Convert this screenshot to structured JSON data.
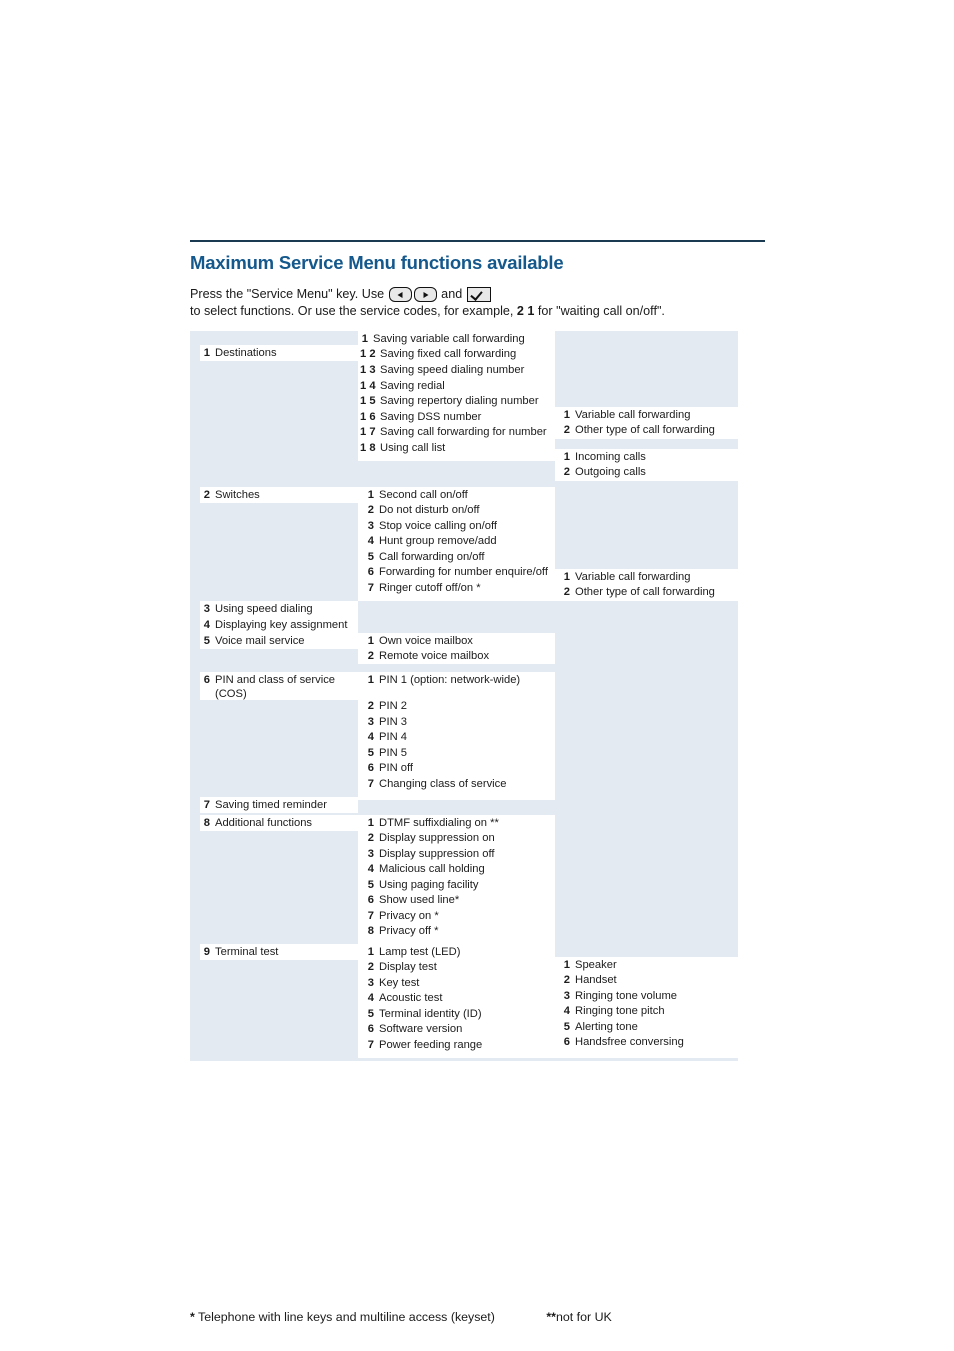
{
  "header": {
    "title": "Maximum Service Menu functions available",
    "intro_line1_a": "Press the \"Service Menu\" key. Use ",
    "intro_line1_b": " and ",
    "intro_line2_a": "to select functions. Or use the service codes, for example, ",
    "intro_line2_code": "2 1",
    "intro_line2_b": " for \"waiting call on/off\"."
  },
  "icons": {
    "left_key": "left-arrow-key-icon",
    "right_key": "right-arrow-key-icon",
    "ok_key": "checkmark-key-icon"
  },
  "table": {
    "col1": [
      {
        "num": "1",
        "label": "Destinations"
      },
      {
        "num": "2",
        "label": "Switches"
      },
      {
        "num": "3",
        "label": "Using speed dialing"
      },
      {
        "num": "4",
        "label": "Displaying key assignment"
      },
      {
        "num": "5",
        "label": "Voice mail service"
      },
      {
        "num": "6",
        "label": "PIN and class of service",
        "label2": "(COS)"
      },
      {
        "num": "7",
        "label": "Saving timed reminder"
      },
      {
        "num": "8",
        "label": "Additional functions"
      },
      {
        "num": "9",
        "label": "Terminal test"
      }
    ],
    "col2_destinations": [
      {
        "num": "1",
        "label": "Saving variable call forwarding"
      },
      {
        "num": "1 2",
        "label": "Saving fixed call forwarding"
      },
      {
        "num": "1 3",
        "label": "Saving speed dialing number"
      },
      {
        "num": "1 4",
        "label": "Saving redial"
      },
      {
        "num": "1 5",
        "label": "Saving repertory dialing number"
      },
      {
        "num": "1 6",
        "label": "Saving DSS number"
      },
      {
        "num": "1 7",
        "label": "Saving call forwarding for number"
      },
      {
        "num": "1 8",
        "label": "Using call list"
      }
    ],
    "col2_switches": [
      {
        "num": "1",
        "label": "Second call on/off"
      },
      {
        "num": "2",
        "label": "Do not disturb on/off"
      },
      {
        "num": "3",
        "label": "Stop voice calling on/off"
      },
      {
        "num": "4",
        "label": "Hunt group remove/add"
      },
      {
        "num": "5",
        "label": "Call forwarding on/off"
      },
      {
        "num": "6",
        "label": "Forwarding for number enquire/off"
      },
      {
        "num": "7",
        "label": "Ringer cutoff off/on  *"
      }
    ],
    "col2_voicemail": [
      {
        "num": "1",
        "label": "Own voice mailbox"
      },
      {
        "num": "2",
        "label": "Remote voice mailbox"
      }
    ],
    "col2_pin": [
      {
        "num": "1",
        "label": "PIN 1 (option: network-wide)"
      },
      {
        "num": "2",
        "label": "PIN 2"
      },
      {
        "num": "3",
        "label": "PIN 3"
      },
      {
        "num": "4",
        "label": "PIN 4"
      },
      {
        "num": "5",
        "label": "PIN 5"
      },
      {
        "num": "6",
        "label": "PIN off"
      },
      {
        "num": "7",
        "label": "Changing class of service"
      }
    ],
    "col2_additional": [
      {
        "num": "1",
        "label": "DTMF suffixdialing on  **"
      },
      {
        "num": "2",
        "label": "Display suppression on"
      },
      {
        "num": "3",
        "label": "Display suppression off"
      },
      {
        "num": "4",
        "label": "Malicious call holding"
      },
      {
        "num": "5",
        "label": "Using paging facility"
      },
      {
        "num": "6",
        "label": "Show used line*"
      },
      {
        "num": "7",
        "label": "Privacy on *"
      },
      {
        "num": "8",
        "label": "Privacy off *"
      }
    ],
    "col2_terminal": [
      {
        "num": "1",
        "label": "Lamp test (LED)"
      },
      {
        "num": "2",
        "label": "Display test"
      },
      {
        "num": "3",
        "label": "Key test"
      },
      {
        "num": "4",
        "label": "Acoustic test"
      },
      {
        "num": "5",
        "label": "Terminal identity (ID)"
      },
      {
        "num": "6",
        "label": "Software version"
      },
      {
        "num": "7",
        "label": "Power feeding range"
      }
    ],
    "col3_forwarding_a": [
      {
        "num": "1",
        "label": "Variable call forwarding"
      },
      {
        "num": "2",
        "label": "Other type of call forwarding"
      }
    ],
    "col3_calls": [
      {
        "num": "1",
        "label": "Incoming calls"
      },
      {
        "num": "2",
        "label": "Outgoing calls"
      }
    ],
    "col3_forwarding_b": [
      {
        "num": "1",
        "label": "Variable call forwarding"
      },
      {
        "num": "2",
        "label": "Other type of call forwarding"
      }
    ],
    "col3_terminal": [
      {
        "num": "1",
        "label": "Speaker"
      },
      {
        "num": "2",
        "label": "Handset"
      },
      {
        "num": "3",
        "label": "Ringing tone volume"
      },
      {
        "num": "4",
        "label": "Ringing tone pitch"
      },
      {
        "num": "5",
        "label": "Alerting tone"
      },
      {
        "num": "6",
        "label": "Handsfree conversing"
      }
    ]
  },
  "footnotes": {
    "star_mark": "*",
    "star_text": " Telephone with line keys and multiline access (keyset)",
    "dstar_mark": "**",
    "dstar_text": "not for UK"
  },
  "colors": {
    "title": "#14588c",
    "rule": "#1a3a52",
    "table_bg": "#e4eaf1",
    "box_bg": "#ffffff"
  }
}
